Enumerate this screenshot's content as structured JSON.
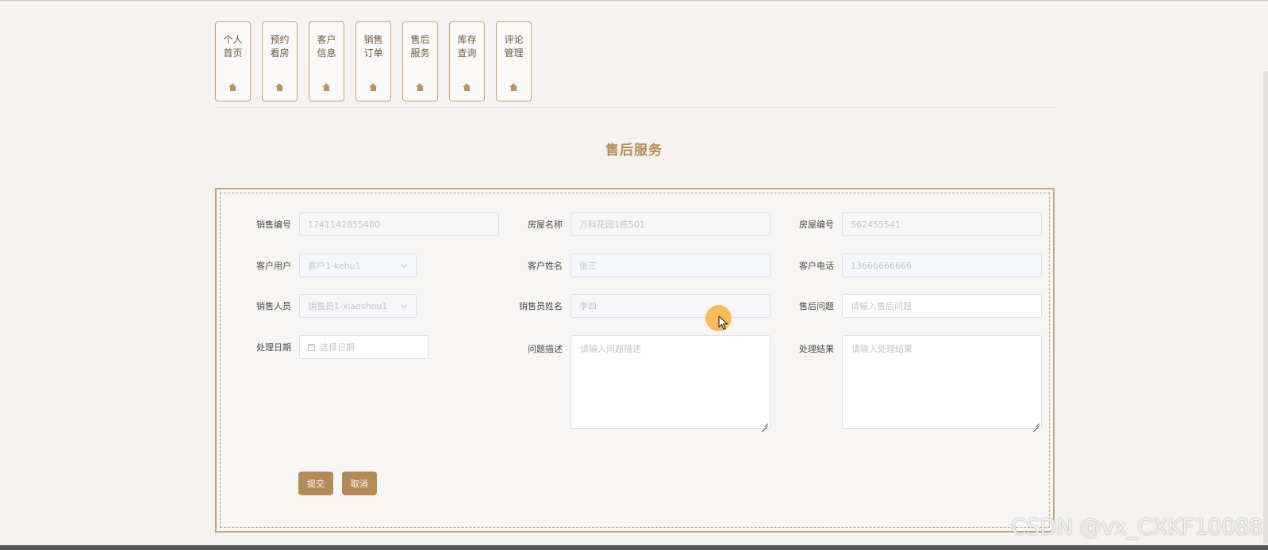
{
  "nav": {
    "items": [
      {
        "label": "个人首页",
        "icon": "home-icon"
      },
      {
        "label": "预约看房",
        "icon": "home-icon"
      },
      {
        "label": "客户信息",
        "icon": "home-icon"
      },
      {
        "label": "销售订单",
        "icon": "home-icon"
      },
      {
        "label": "售后服务",
        "icon": "home-icon"
      },
      {
        "label": "库存查询",
        "icon": "home-icon"
      },
      {
        "label": "评论管理",
        "icon": "home-icon"
      }
    ]
  },
  "page": {
    "title": "售后服务"
  },
  "form": {
    "sales_no": {
      "label": "销售编号",
      "value": "1741142855480"
    },
    "house_name": {
      "label": "房屋名称",
      "value": "万科花园1栋501"
    },
    "house_no": {
      "label": "房屋编号",
      "value": "562455541"
    },
    "customer_user": {
      "label": "客户用户",
      "value": "客户1-kehu1"
    },
    "customer_name": {
      "label": "客户姓名",
      "value": "张三"
    },
    "customer_phone": {
      "label": "客户电话",
      "value": "13666666666"
    },
    "sales_person": {
      "label": "销售人员",
      "value": "销售员1-xiaoshou1"
    },
    "sales_person_name": {
      "label": "销售员姓名",
      "value": "李四"
    },
    "after_sales_issue": {
      "label": "售后问题",
      "placeholder": "请输入售后问题"
    },
    "handle_date": {
      "label": "处理日期",
      "placeholder": "选择日期"
    },
    "issue_desc": {
      "label": "问题描述",
      "placeholder": "请输入问题描述"
    },
    "handle_result": {
      "label": "处理结果",
      "placeholder": "请输入处理结果"
    },
    "submit_label": "提交",
    "cancel_label": "取消"
  },
  "watermark": "CSDN @vx_CXKF10088",
  "colors": {
    "accent": "#b48a56",
    "border": "#c6a574",
    "background": "#f5f2ef",
    "cursor_highlight": "#f7b64a"
  }
}
